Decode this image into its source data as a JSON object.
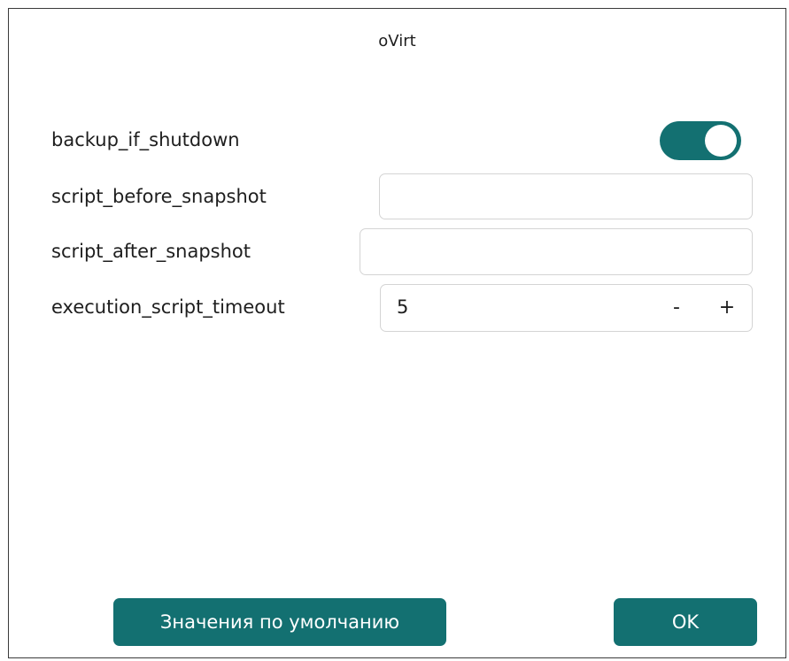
{
  "dialog": {
    "title": "oVirt"
  },
  "settings": {
    "backup_if_shutdown": {
      "label": "backup_if_shutdown",
      "enabled": true
    },
    "script_before_snapshot": {
      "label": "script_before_snapshot",
      "value": ""
    },
    "script_after_snapshot": {
      "label": "script_after_snapshot",
      "value": ""
    },
    "execution_script_timeout": {
      "label": "execution_script_timeout",
      "value": "5",
      "decrement": "-",
      "increment": "+"
    }
  },
  "footer": {
    "defaults_label": "Значения по умолчанию",
    "ok_label": "OK"
  },
  "colors": {
    "accent": "#137071",
    "border": "#d4d4d4"
  }
}
